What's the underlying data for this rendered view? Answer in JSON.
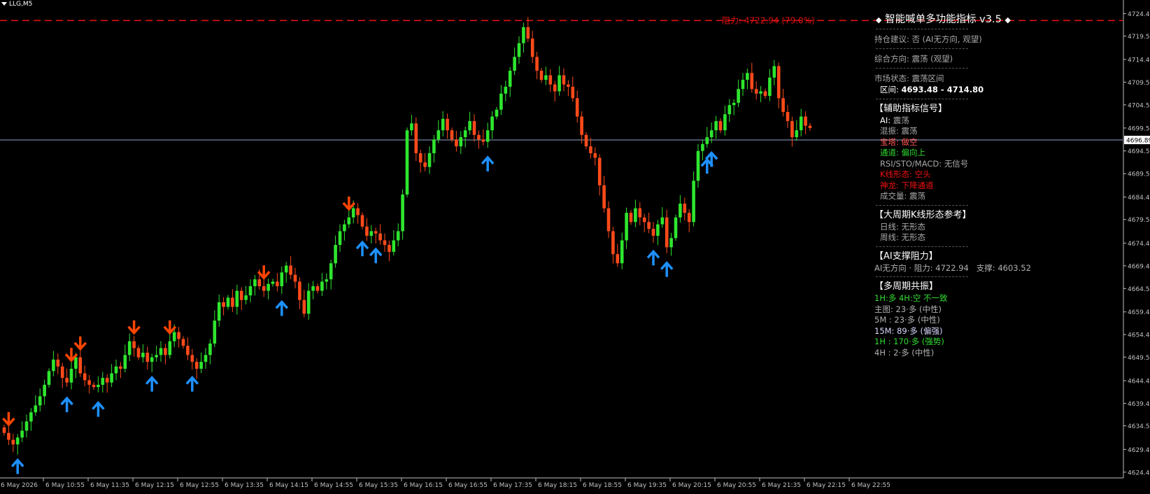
{
  "colors": {
    "background": "#000000",
    "bull": "#2ee62e",
    "bear": "#ff4a1a",
    "resistance_line": "#e01010",
    "current_price_line": "#8aa5c8",
    "up_arrow": "#1e90ff",
    "down_arrow": "#ff4500",
    "axis_text": "#c0c0c0",
    "axis_line": "#c0c0c0"
  },
  "chart": {
    "symbol_label": "LLG,M5",
    "resistance_label": "阻力: 4722.94 (79.0%)",
    "current_price_tag": "4696.89"
  },
  "chart_data": {
    "type": "candlestick",
    "symbol": "LLG",
    "timeframe": "M5",
    "ylim": [
      4623.5,
      4726.5
    ],
    "yticks": [
      "4724.45",
      "4719.55",
      "4714.45",
      "4709.50",
      "4704.55",
      "4699.50",
      "4694.50",
      "4689.55",
      "4684.45",
      "4679.55",
      "4674.40",
      "4669.45",
      "4664.50",
      "4659.40",
      "4654.45",
      "4649.55",
      "4644.40",
      "4639.45",
      "4634.55",
      "4629.40",
      "4624.45"
    ],
    "xticks": [
      "6 May 2026",
      "6 May 10:55",
      "6 May 11:35",
      "6 May 12:15",
      "6 May 12:55",
      "6 May 13:35",
      "6 May 14:15",
      "6 May 14:55",
      "6 May 15:35",
      "6 May 16:15",
      "6 May 16:55",
      "6 May 17:35",
      "6 May 18:15",
      "6 May 18:55",
      "6 May 19:35",
      "6 May 20:15",
      "6 May 20:55",
      "6 May 21:35",
      "6 May 22:15",
      "6 May 22:55"
    ],
    "resistance_level": 4722.94,
    "current_price": 4696.89,
    "closes": [
      4633,
      4631.5,
      4630.5,
      4632,
      4633.5,
      4635.5,
      4637.5,
      4639,
      4641,
      4643.5,
      4646.5,
      4649,
      4647.5,
      4645,
      4644,
      4647,
      4649.5,
      4646,
      4644.5,
      4643.5,
      4643,
      4643.5,
      4645,
      4644,
      4646,
      4647.5,
      4647,
      4650,
      4653,
      4651.5,
      4649.5,
      4650.5,
      4648.5,
      4649.5,
      4650,
      4651.5,
      4650,
      4653,
      4655,
      4653.5,
      4652,
      4650,
      4648.5,
      4647,
      4648.5,
      4650,
      4652.5,
      4657.5,
      4661.5,
      4660.5,
      4662.5,
      4660.5,
      4664,
      4662,
      4663,
      4665,
      4666.5,
      4665,
      4664,
      4665.5,
      4666,
      4665,
      4668,
      4669.5,
      4667.5,
      4666,
      4662,
      4659,
      4664,
      4665,
      4664,
      4666,
      4666.5,
      4670,
      4674,
      4677,
      4678.5,
      4680,
      4682,
      4680.5,
      4678,
      4676,
      4677,
      4676.5,
      4675,
      4674,
      4672.5,
      4675,
      4677,
      4685,
      4699,
      4700.5,
      4694,
      4692,
      4691,
      4694,
      4697,
      4699,
      4701.5,
      4699,
      4697,
      4695.5,
      4697.5,
      4699,
      4701,
      4698,
      4697,
      4696.5,
      4699,
      4702,
      4703.5,
      4707,
      4708.5,
      4712,
      4715,
      4718,
      4721.5,
      4719,
      4715,
      4712,
      4710,
      4711,
      4709,
      4707.5,
      4711,
      4709,
      4708.5,
      4706,
      4702,
      4698,
      4695.5,
      4694,
      4693,
      4687,
      4682,
      4677,
      4672,
      4670,
      4675,
      4681,
      4679,
      4682,
      4680,
      4679,
      4677.5,
      4676,
      4678.5,
      4680,
      4673.5,
      4675.5,
      4680,
      4683,
      4681,
      4679,
      4688,
      4694.5,
      4696,
      4697.5,
      4699,
      4701,
      4699,
      4702.5,
      4704.5,
      4705,
      4708,
      4710,
      4711.5,
      4708,
      4707,
      4707.5,
      4706.5,
      4710.5,
      4713,
      4706,
      4703,
      4701,
      4697.5,
      4699,
      4702,
      4700,
      4699.5
    ]
  },
  "y_axis_labels": [
    "4724.45",
    "4719.55",
    "4714.45",
    "4709.50",
    "4704.55",
    "4699.50",
    "4694.50",
    "4689.55",
    "4684.45",
    "4679.55",
    "4674.40",
    "4669.45",
    "4664.50",
    "4659.40",
    "4654.45",
    "4649.55",
    "4644.40",
    "4639.45",
    "4634.55",
    "4629.40",
    "4624.45"
  ],
  "x_axis_labels": [
    "6 May 2026",
    "6 May 10:55",
    "6 May 11:35",
    "6 May 12:15",
    "6 May 12:55",
    "6 May 13:35",
    "6 May 14:15",
    "6 May 14:55",
    "6 May 15:35",
    "6 May 16:15",
    "6 May 16:55",
    "6 May 17:35",
    "6 May 18:15",
    "6 May 18:55",
    "6 May 19:35",
    "6 May 20:15",
    "6 May 20:55",
    "6 May 21:35",
    "6 May 22:15",
    "6 May 22:55"
  ],
  "signals": {
    "up_bar_indices": [
      3,
      14,
      21,
      33,
      42,
      62,
      80,
      83,
      108,
      145,
      148,
      157,
      158
    ],
    "down_bar_indices": [
      1,
      15,
      17,
      29,
      37,
      58,
      77
    ]
  },
  "panel": {
    "title": "智能喊单多功能指标 v3.5",
    "title_diamond": "◆",
    "position_advice_label": "持仓建议:",
    "position_advice_value": "否 (AI无方向, 观望)",
    "composite_direction_label": "综合方向:",
    "composite_direction_value": "震荡 (观望)",
    "market_state_label": "市场状态:",
    "market_state_value": "震荡区间",
    "range_label": "区间:",
    "range_value": "4693.48 - 4714.80",
    "aux_header": "【辅助指标信号】",
    "aux": {
      "ai_label": "AI:",
      "ai_value": "震荡",
      "chaos_label": "混振:",
      "chaos_value": "震荡",
      "tower_label": "宝塔:",
      "tower_value": "做空",
      "channel_label": "通道:",
      "channel_value": "偏向上",
      "rsi_label": "RSI/STO/MACD:",
      "rsi_value": "无信号",
      "kpattern_label": "K线形态:",
      "kpattern_value": "空头",
      "dragon_label": "神龙:",
      "dragon_value": "下降通道",
      "volume_label": "成交量:",
      "volume_value": "震荡"
    },
    "period_header": "【大周期K线形态参考】",
    "daily_label": "日线:",
    "daily_value": "无形态",
    "weekly_label": "周线:",
    "weekly_value": "无形态",
    "sr_header": "【AI支撑阻力】",
    "sr_prefix": "AI无方向 · 阻力:",
    "sr_resistance": "4722.94",
    "sr_support_label": "支撑:",
    "sr_support": "4603.52",
    "resonance_header": "【多周期共振】",
    "resonance_summary_a": "1H:多 4H:空",
    "resonance_summary_b": "不一致",
    "res_main": "主图: 23·多 (中性)",
    "res_5m": "5M : 23·多 (中性)",
    "res_15m": "15M: 89·多 (偏强)",
    "res_1h": "1H : 170·多 (强势)",
    "res_4h": "4H : 2·多 (中性)"
  }
}
